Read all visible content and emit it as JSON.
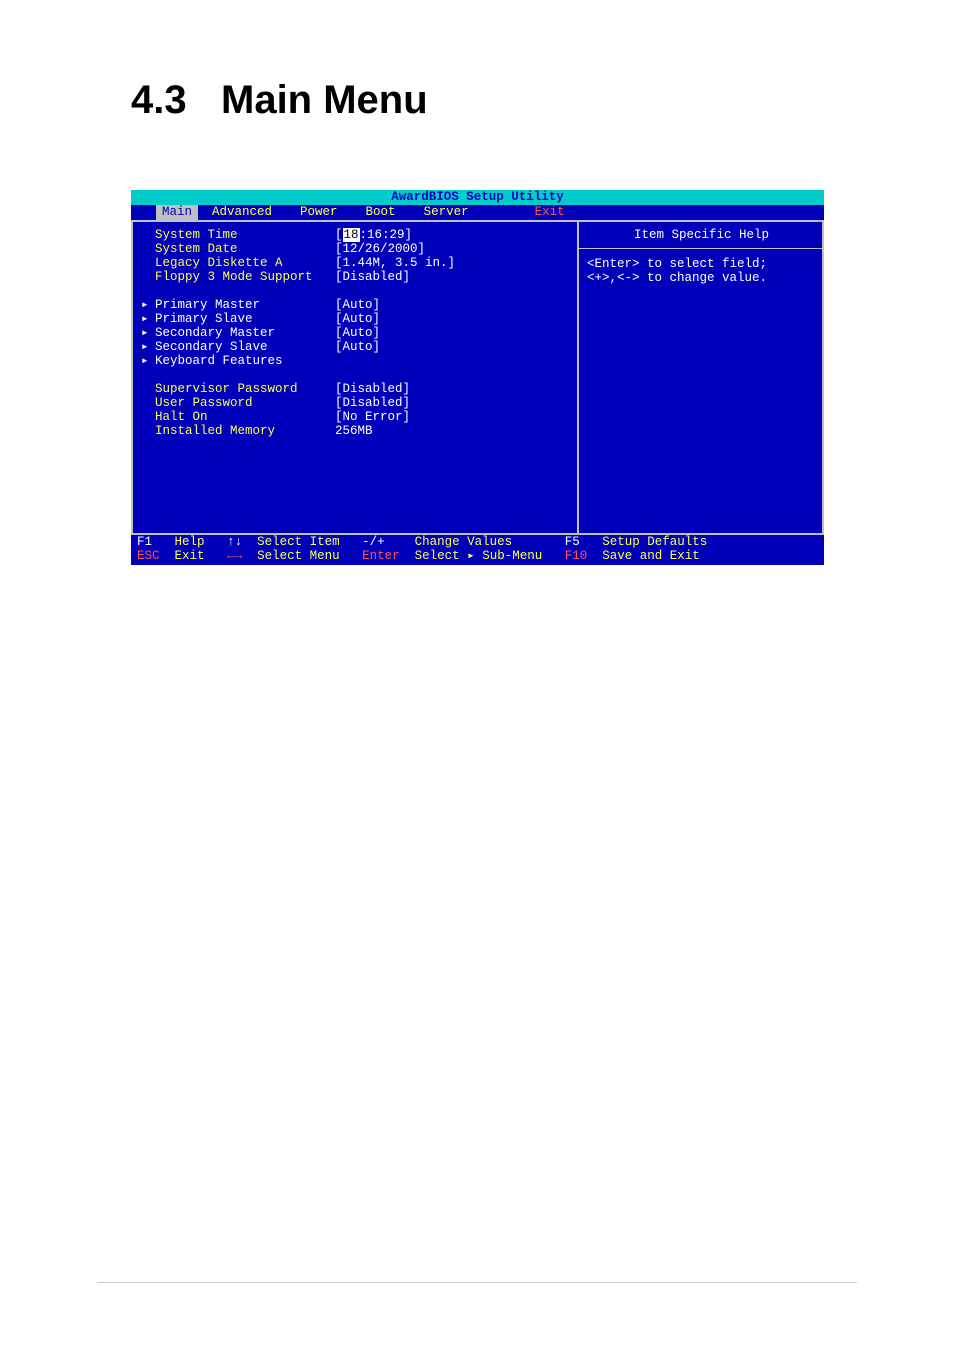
{
  "heading": {
    "number": "4.3",
    "title": "Main Menu"
  },
  "bios": {
    "title": "AwardBIOS Setup Utility",
    "menu": {
      "items": [
        "Main",
        "Advanced",
        "Power",
        "Boot",
        "Server"
      ],
      "exit": "Exit",
      "selected": "Main"
    },
    "left": {
      "group1": [
        {
          "arrow": "",
          "label": "System Time",
          "value_pre": "[",
          "cursor": "18",
          "value_post": ":16:29]"
        },
        {
          "arrow": "",
          "label": "System Date",
          "value": "[12/26/2000]"
        },
        {
          "arrow": "",
          "label": "Legacy Diskette A",
          "value": "[1.44M, 3.5 in.]"
        },
        {
          "arrow": "",
          "label": "Floppy 3 Mode Support",
          "value": "[Disabled]"
        }
      ],
      "group2": [
        {
          "arrow": "▸",
          "label": "Primary Master",
          "value": "[Auto]"
        },
        {
          "arrow": "▸",
          "label": "Primary Slave",
          "value": "[Auto]"
        },
        {
          "arrow": "▸",
          "label": "Secondary Master",
          "value": "[Auto]"
        },
        {
          "arrow": "▸",
          "label": "Secondary Slave",
          "value": "[Auto]"
        },
        {
          "arrow": "▸",
          "label": "Keyboard Features",
          "value": ""
        }
      ],
      "group3": [
        {
          "arrow": "",
          "label": "Supervisor Password",
          "value": "[Disabled]"
        },
        {
          "arrow": "",
          "label": "User Password",
          "value": "[Disabled]"
        },
        {
          "arrow": "",
          "label": "Halt On",
          "value": "[No Error]"
        },
        {
          "arrow": "",
          "label": "Installed Memory",
          "value": "256MB"
        }
      ]
    },
    "help": {
      "title": "Item Specific Help",
      "line1": "<Enter> to select field;",
      "line2": "<+>,<-> to change value."
    },
    "footer": {
      "l1": {
        "k1": "F1",
        "t1": "Help",
        "k2": "↑↓",
        "t2": "Select Item",
        "k3": "-/+",
        "t3": "Change Values",
        "k4": "F5",
        "t4": "Setup Defaults"
      },
      "l2": {
        "k1": "ESC",
        "t1": "Exit",
        "k2": "←→",
        "t2": "Select Menu",
        "k3": "Enter",
        "t3": "Select ▸ Sub-Menu",
        "k4": "F10",
        "t4": "Save and Exit"
      }
    }
  }
}
